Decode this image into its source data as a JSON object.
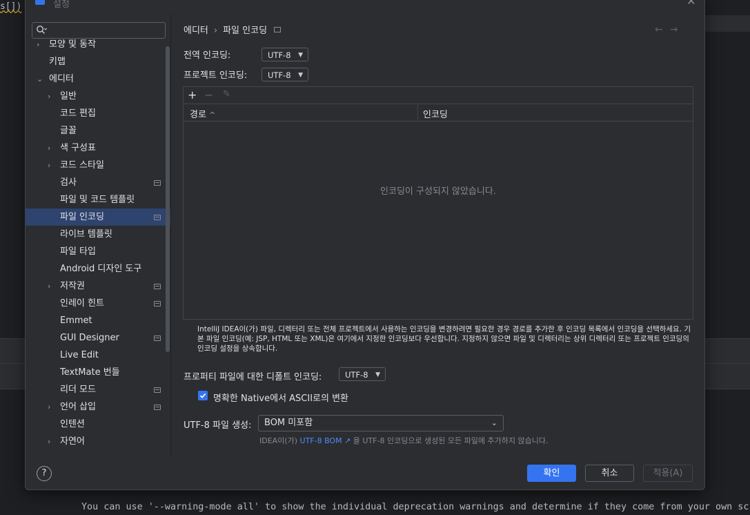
{
  "background": {
    "code_fragment": "s[])",
    "console_text": "You can use '--warning-mode all' to show the individual deprecation warnings and determine if they come from your own scr"
  },
  "dialog": {
    "title": "설정"
  },
  "sidebar": {
    "search_placeholder": "",
    "items": [
      {
        "label": "모양 및 동작",
        "chevron": "›",
        "indent": 0,
        "badge": false,
        "selected": false
      },
      {
        "label": "키맵",
        "chevron": "",
        "indent": 0,
        "badge": false,
        "selected": false
      },
      {
        "label": "에디터",
        "chevron": "⌄",
        "indent": 0,
        "badge": false,
        "selected": false
      },
      {
        "label": "일반",
        "chevron": "›",
        "indent": 1,
        "badge": false,
        "selected": false
      },
      {
        "label": "코드 편집",
        "chevron": "",
        "indent": 1,
        "badge": false,
        "selected": false
      },
      {
        "label": "글꼴",
        "chevron": "",
        "indent": 1,
        "badge": false,
        "selected": false
      },
      {
        "label": "색 구성표",
        "chevron": "›",
        "indent": 1,
        "badge": false,
        "selected": false
      },
      {
        "label": "코드 스타일",
        "chevron": "›",
        "indent": 1,
        "badge": false,
        "selected": false
      },
      {
        "label": "검사",
        "chevron": "",
        "indent": 1,
        "badge": true,
        "selected": false
      },
      {
        "label": "파일 및 코드 템플릿",
        "chevron": "",
        "indent": 1,
        "badge": false,
        "selected": false
      },
      {
        "label": "파일 인코딩",
        "chevron": "",
        "indent": 1,
        "badge": true,
        "selected": true
      },
      {
        "label": "라이브 템플릿",
        "chevron": "",
        "indent": 1,
        "badge": false,
        "selected": false
      },
      {
        "label": "파일 타입",
        "chevron": "",
        "indent": 1,
        "badge": false,
        "selected": false
      },
      {
        "label": "Android 디자인 도구",
        "chevron": "",
        "indent": 1,
        "badge": false,
        "selected": false
      },
      {
        "label": "저작권",
        "chevron": "›",
        "indent": 1,
        "badge": true,
        "selected": false
      },
      {
        "label": "인레이 힌트",
        "chevron": "",
        "indent": 1,
        "badge": true,
        "selected": false
      },
      {
        "label": "Emmet",
        "chevron": "",
        "indent": 1,
        "badge": false,
        "selected": false
      },
      {
        "label": "GUI Designer",
        "chevron": "",
        "indent": 1,
        "badge": true,
        "selected": false
      },
      {
        "label": "Live Edit",
        "chevron": "",
        "indent": 1,
        "badge": false,
        "selected": false
      },
      {
        "label": "TextMate 번들",
        "chevron": "",
        "indent": 1,
        "badge": false,
        "selected": false
      },
      {
        "label": "리더 모드",
        "chevron": "",
        "indent": 1,
        "badge": true,
        "selected": false
      },
      {
        "label": "언어 삽입",
        "chevron": "›",
        "indent": 1,
        "badge": true,
        "selected": false
      },
      {
        "label": "인텐션",
        "chevron": "",
        "indent": 1,
        "badge": false,
        "selected": false
      },
      {
        "label": "자연어",
        "chevron": "›",
        "indent": 1,
        "badge": false,
        "selected": false
      }
    ]
  },
  "content": {
    "breadcrumb": {
      "parent": "에디터",
      "separator": "›",
      "current": "파일 인코딩"
    },
    "global_encoding": {
      "label": "전역 인코딩:",
      "value": "UTF-8"
    },
    "project_encoding": {
      "label": "프로젝트 인코딩:",
      "value": "UTF-8"
    },
    "table": {
      "col_path": "경로",
      "col_path_sort": "^",
      "col_encoding": "인코딩",
      "empty_message": "인코딩이 구성되지 않았습니다."
    },
    "description": "IntelliJ IDEA이(가) 파일, 디렉터리 또는 전체 프로젝트에서 사용하는 인코딩을 변경하려면 필요한 경우 경로를 추가한 후 인코딩 목록에서 인코딩을 선택하세요. 기본 파일 인코딩(예: JSP, HTML 또는 XML)은 여기에서 지정한 인코딩보다 우선합니다. 지정하지 않으면 파일 및 디렉터리는 상위 디렉터리 또는 프로젝트 인코딩의 인코딩 설정을 상속합니다.",
    "properties_encoding": {
      "label": "프로퍼티 파일에 대한 디폴트 인코딩:",
      "value": "UTF-8"
    },
    "native_to_ascii": {
      "label": "명확한 Native에서 ASCII로의 변환",
      "checked": true
    },
    "bom": {
      "label": "UTF-8 파일 생성:",
      "value": "BOM 미포함"
    },
    "hint": {
      "prefix": "IDEA이(가) ",
      "link": "UTF-8 BOM ↗",
      "suffix": " 을 UTF-8 인코딩으로 생성된 모든 파일에 추가하지 않습니다."
    }
  },
  "footer": {
    "help": "?",
    "ok": "확인",
    "cancel": "취소",
    "apply": "적용(A)"
  },
  "colors": {
    "accent": "#3574f0",
    "selection": "#2e436e",
    "link": "#548af7"
  }
}
